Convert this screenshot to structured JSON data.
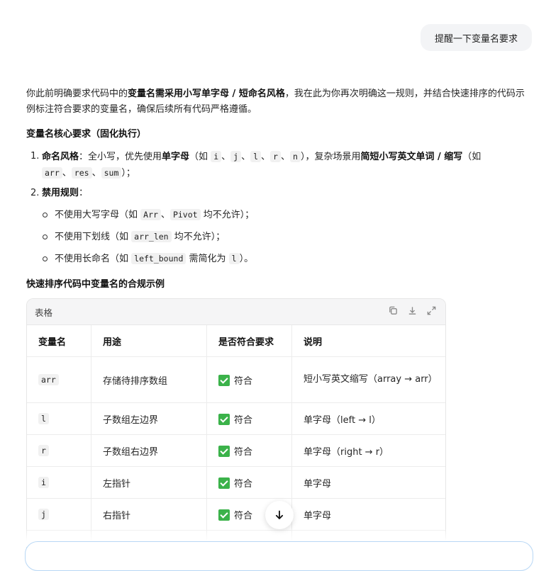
{
  "user_message": "提醒一下变量名要求",
  "intro": {
    "p1": "你此前明确要求代码中的",
    "b1": "变量名需采用小写单字母 / 短命名风格",
    "p2": "，我在此为你再次明确这一规则，并结合快速排序的代码示例标注符合要求的变量名，确保后续所有代码严格遵循。"
  },
  "section1_title": "变量名核心要求（固化执行）",
  "rule1": {
    "num": "1.",
    "label": "命名风格",
    "t1": "：全小写，优先使用",
    "b1": "单字母",
    "t2": "（如 ",
    "codes": [
      "i",
      "j",
      "l",
      "r",
      "n",
      "arr",
      "res",
      "sum"
    ],
    "t3": "），复杂场景用",
    "b2": "简短小写英文单词 / 缩写",
    "t4": "（如",
    "t5": "）；",
    "sep": "、"
  },
  "rule2": {
    "num": "2.",
    "label": "禁用规则",
    "colon": "：",
    "items": [
      {
        "pre": "不使用大写字母（如 ",
        "codes": [
          "Arr",
          "Pivot"
        ],
        "post": " 均不允许）；"
      },
      {
        "pre": "不使用下划线（如 ",
        "codes": [
          "arr_len"
        ],
        "post": " 均不允许）；"
      },
      {
        "pre": "不使用长命名（如 ",
        "codes": [
          "left_bound"
        ],
        "mid": " 需简化为 ",
        "codes2": [
          "l"
        ],
        "post": "）。"
      }
    ]
  },
  "section2_title": "快速排序代码中变量名的合规示例",
  "table": {
    "caption": "表格",
    "headers": [
      "变量名",
      "用途",
      "是否符合要求",
      "说明"
    ],
    "rows": [
      {
        "var": "arr",
        "use": "存储待排序数组",
        "ok": "符合",
        "note": "短小写英文缩写（array → arr）"
      },
      {
        "var": "l",
        "use": "子数组左边界",
        "ok": "符合",
        "note": "单字母（left → l）"
      },
      {
        "var": "r",
        "use": "子数组右边界",
        "ok": "符合",
        "note": "单字母（right → r）"
      },
      {
        "var": "i",
        "use": "左指针",
        "ok": "符合",
        "note": "单字母"
      },
      {
        "var": "j",
        "use": "右指针",
        "ok": "符合",
        "note": "单字母"
      }
    ]
  },
  "icons": {
    "copy": "copy-icon",
    "download": "download-icon",
    "expand": "expand-icon",
    "scroll": "arrow-down-icon",
    "check": "check-mark-icon"
  },
  "colors": {
    "check": "#3bb24a",
    "composer_border": "#b8d7f5",
    "bubble": "#f3f4f6"
  }
}
